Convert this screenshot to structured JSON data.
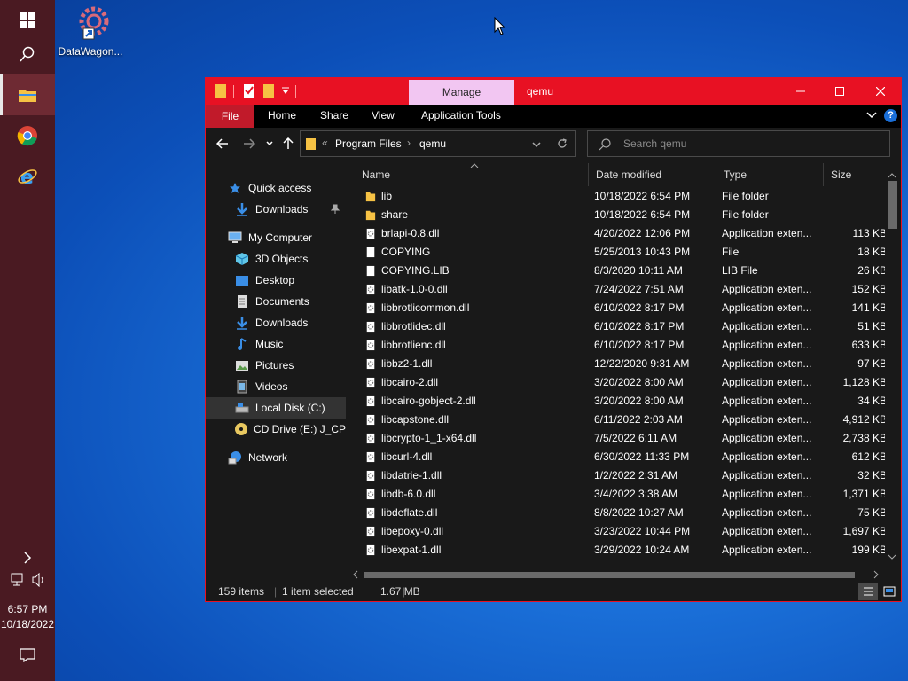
{
  "desktop": {
    "icon_label": "DataWagon..."
  },
  "taskbar": {
    "clock_time": "6:57 PM",
    "clock_date": "10/18/2022"
  },
  "window": {
    "title": "qemu",
    "manage_tab": "Manage",
    "ribbon_tabs": [
      "File",
      "Home",
      "Share",
      "View",
      "Application Tools"
    ],
    "address": {
      "chevron": "«",
      "crumbs": [
        "Program Files",
        "qemu"
      ]
    },
    "search_placeholder": "Search qemu",
    "accent": "#e81123"
  },
  "nav_pane": {
    "items": [
      {
        "label": "Quick access",
        "icon": "star-icon"
      },
      {
        "label": "Downloads",
        "icon": "download-arrow-icon"
      },
      {
        "label": "My Computer",
        "icon": "computer-icon"
      },
      {
        "label": "3D Objects",
        "icon": "cube-icon"
      },
      {
        "label": "Desktop",
        "icon": "desktop-icon"
      },
      {
        "label": "Documents",
        "icon": "document-icon"
      },
      {
        "label": "Downloads",
        "icon": "download-arrow-icon"
      },
      {
        "label": "Music",
        "icon": "music-note-icon"
      },
      {
        "label": "Pictures",
        "icon": "picture-icon"
      },
      {
        "label": "Videos",
        "icon": "film-icon"
      },
      {
        "label": "Local Disk (C:)",
        "icon": "drive-icon"
      },
      {
        "label": "CD Drive (E:) J_CPRA",
        "icon": "cd-icon"
      },
      {
        "label": "Network",
        "icon": "network-icon"
      }
    ]
  },
  "file_list": {
    "columns": [
      "Name",
      "Date modified",
      "Type",
      "Size"
    ],
    "rows": [
      {
        "name": "lib",
        "date": "10/18/2022 6:54 PM",
        "type": "File folder",
        "size": "",
        "kind": "folder"
      },
      {
        "name": "share",
        "date": "10/18/2022 6:54 PM",
        "type": "File folder",
        "size": "",
        "kind": "folder"
      },
      {
        "name": "brlapi-0.8.dll",
        "date": "4/20/2022 12:06 PM",
        "type": "Application exten...",
        "size": "113 KB",
        "kind": "dll"
      },
      {
        "name": "COPYING",
        "date": "5/25/2013 10:43 PM",
        "type": "File",
        "size": "18 KB",
        "kind": "file"
      },
      {
        "name": "COPYING.LIB",
        "date": "8/3/2020 10:11 AM",
        "type": "LIB File",
        "size": "26 KB",
        "kind": "file"
      },
      {
        "name": "libatk-1.0-0.dll",
        "date": "7/24/2022 7:51 AM",
        "type": "Application exten...",
        "size": "152 KB",
        "kind": "dll"
      },
      {
        "name": "libbrotlicommon.dll",
        "date": "6/10/2022 8:17 PM",
        "type": "Application exten...",
        "size": "141 KB",
        "kind": "dll"
      },
      {
        "name": "libbrotlidec.dll",
        "date": "6/10/2022 8:17 PM",
        "type": "Application exten...",
        "size": "51 KB",
        "kind": "dll"
      },
      {
        "name": "libbrotlienc.dll",
        "date": "6/10/2022 8:17 PM",
        "type": "Application exten...",
        "size": "633 KB",
        "kind": "dll"
      },
      {
        "name": "libbz2-1.dll",
        "date": "12/22/2020 9:31 AM",
        "type": "Application exten...",
        "size": "97 KB",
        "kind": "dll"
      },
      {
        "name": "libcairo-2.dll",
        "date": "3/20/2022 8:00 AM",
        "type": "Application exten...",
        "size": "1,128 KB",
        "kind": "dll"
      },
      {
        "name": "libcairo-gobject-2.dll",
        "date": "3/20/2022 8:00 AM",
        "type": "Application exten...",
        "size": "34 KB",
        "kind": "dll"
      },
      {
        "name": "libcapstone.dll",
        "date": "6/11/2022 2:03 AM",
        "type": "Application exten...",
        "size": "4,912 KB",
        "kind": "dll"
      },
      {
        "name": "libcrypto-1_1-x64.dll",
        "date": "7/5/2022 6:11 AM",
        "type": "Application exten...",
        "size": "2,738 KB",
        "kind": "dll"
      },
      {
        "name": "libcurl-4.dll",
        "date": "6/30/2022 11:33 PM",
        "type": "Application exten...",
        "size": "612 KB",
        "kind": "dll"
      },
      {
        "name": "libdatrie-1.dll",
        "date": "1/2/2022 2:31 AM",
        "type": "Application exten...",
        "size": "32 KB",
        "kind": "dll"
      },
      {
        "name": "libdb-6.0.dll",
        "date": "3/4/2022 3:38 AM",
        "type": "Application exten...",
        "size": "1,371 KB",
        "kind": "dll"
      },
      {
        "name": "libdeflate.dll",
        "date": "8/8/2022 10:27 AM",
        "type": "Application exten...",
        "size": "75 KB",
        "kind": "dll"
      },
      {
        "name": "libepoxy-0.dll",
        "date": "3/23/2022 10:44 PM",
        "type": "Application exten...",
        "size": "1,697 KB",
        "kind": "dll"
      },
      {
        "name": "libexpat-1.dll",
        "date": "3/29/2022 10:24 AM",
        "type": "Application exten...",
        "size": "199 KB",
        "kind": "dll"
      }
    ]
  },
  "status": {
    "item_count": "159 items",
    "selection": "1 item selected",
    "selection_size": "1.67 MB"
  }
}
